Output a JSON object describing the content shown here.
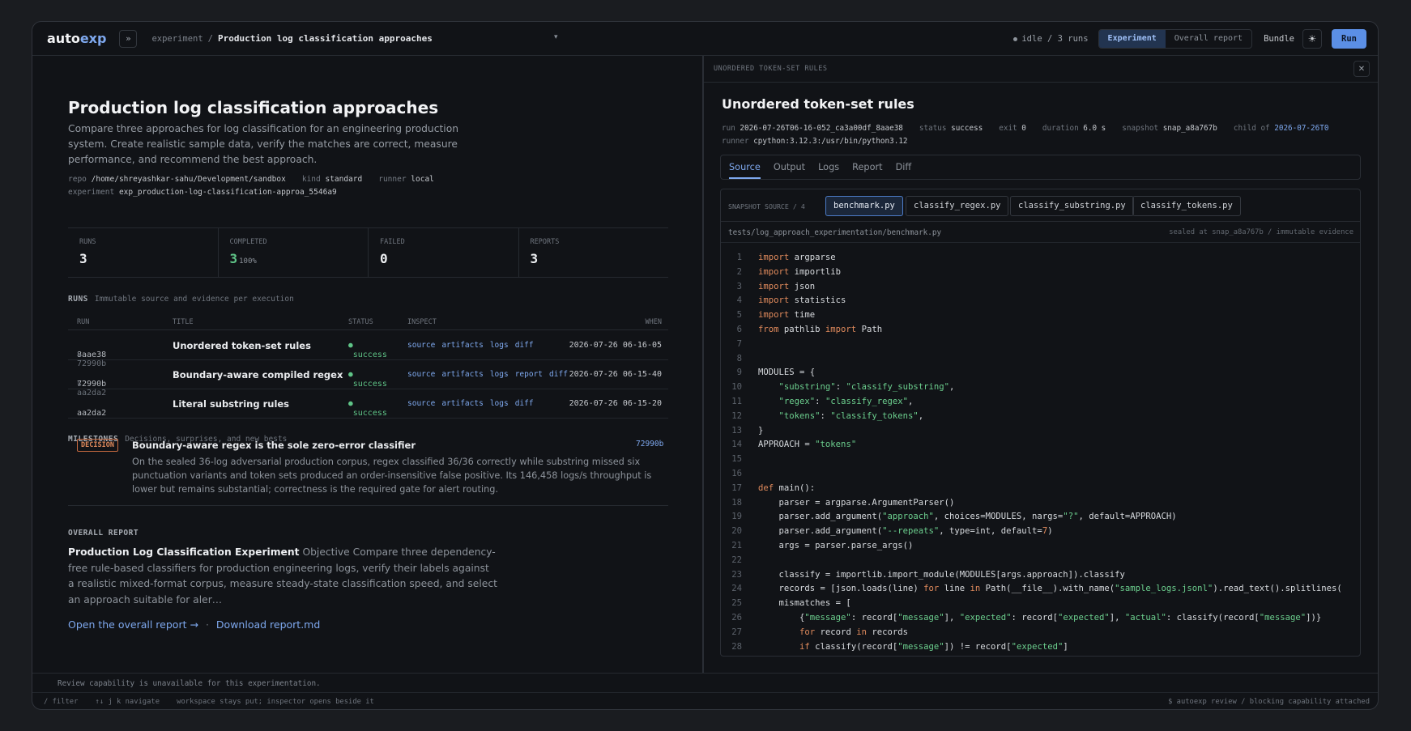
{
  "topbar": {
    "logo_main": "auto",
    "logo_accent": "exp",
    "expand_glyph": "»",
    "crumb_parent": "experiment",
    "crumb_sep": "/",
    "crumb_current": "Production log classification approaches",
    "caret": "▾",
    "status": "idle / 3 runs",
    "tab_experiment": "Experiment",
    "tab_overall": "Overall report",
    "bundle": "Bundle",
    "theme_glyph": "☀",
    "run": "Run"
  },
  "experiment": {
    "title": "Production log classification approaches",
    "description": "Compare three approaches for log classification for an engineering production system. Create realistic sample data, verify the matches are correct, measure performance, and recommend the best approach.",
    "repo_label": "repo",
    "repo": "/home/shreyashkar-sahu/Development/sandbox",
    "kind_label": "kind",
    "kind": "standard",
    "runner_label": "runner",
    "runner": "local",
    "experiment_label": "experiment",
    "experiment_id": "exp_production-log-classification-approa_5546a9"
  },
  "stats": {
    "runs_label": "RUNS",
    "runs": "3",
    "completed_label": "COMPLETED",
    "completed": "3",
    "completed_pct": "100%",
    "failed_label": "FAILED",
    "failed": "0",
    "reports_label": "REPORTS",
    "reports": "3"
  },
  "runs": {
    "title": "RUNS",
    "subtitle": "Immutable source and evidence per execution",
    "col_run": "RUN",
    "col_title": "TITLE",
    "col_status": "STATUS",
    "col_inspect": "INSPECT",
    "col_when": "WHEN",
    "rows": [
      {
        "id": "8aae38",
        "parent": "↳ 72990b",
        "title": "Unordered token-set rules",
        "status": "success",
        "l1": "source",
        "l2": "artifacts",
        "l3": "logs",
        "l4": "diff",
        "l5": "",
        "when": "2026-07-26 06-16-05"
      },
      {
        "id": "72990b",
        "parent": "↳ aa2da2",
        "title": "Boundary-aware compiled regex",
        "status": "success",
        "l1": "source",
        "l2": "artifacts",
        "l3": "logs",
        "l4": "report",
        "l5": "diff",
        "when": "2026-07-26 06-15-40"
      },
      {
        "id": "aa2da2",
        "parent": "",
        "title": "Literal substring rules",
        "status": "success",
        "l1": "source",
        "l2": "artifacts",
        "l3": "logs",
        "l4": "diff",
        "l5": "",
        "when": "2026-07-26 06-15-20"
      }
    ]
  },
  "milestones": {
    "title": "MILESTONES",
    "subtitle": "Decisions, surprises, and new bests",
    "badge": "DECISION",
    "item_title": "Boundary-aware regex is the sole zero-error classifier",
    "item_link": "72990b",
    "item_body": "On the sealed 36-log adversarial production corpus, regex classified 36/36 correctly while substring missed six punctuation variants and token sets produced an order-insensitive false positive. Its 146,458 logs/s throughput is lower but remains substantial; correctness is the required gate for alert routing."
  },
  "overall": {
    "title": "OVERALL REPORT",
    "report_title": "Production Log Classification Experiment",
    "report_text": " Objective Compare three dependency-free rule-based classifiers for production engineering logs, verify their labels against a realistic mixed-format corpus, measure steady-state classification speed, and select an approach suitable for aler…",
    "open_link": "Open the overall report →",
    "sep": "·",
    "download_link": "Download report.md"
  },
  "inspector": {
    "caption": "UNORDERED TOKEN-SET RULES",
    "close": "✕",
    "title": "Unordered token-set rules",
    "run_label": "run",
    "run": "2026-07-26T06-16-052_ca3a00df_8aae38",
    "status_label": "status",
    "status": "success",
    "exit_label": "exit",
    "exit": "0",
    "duration_label": "duration",
    "duration": "6.0 s",
    "snapshot_label": "snapshot",
    "snapshot": "snap_a8a767b",
    "child_label": "child of",
    "child": "2026-07-26T0",
    "runner_label": "runner",
    "runner": "cpython:3.12.3:/usr/bin/python3.12",
    "tabs": {
      "source": "Source",
      "output": "Output",
      "logs": "Logs",
      "report": "Report",
      "diff": "Diff"
    },
    "files_caption": "SNAPSHOT SOURCE / 4",
    "files": [
      "benchmark.py",
      "classify_regex.py",
      "classify_substring.py",
      "classify_tokens.py"
    ],
    "path": "tests/log_approach_experimentation/benchmark.py",
    "sealed": "sealed at snap_a8a767b / immutable evidence"
  },
  "code_lines": [
    "1",
    "2",
    "3",
    "4",
    "5",
    "6",
    "7",
    "8",
    "9",
    "10",
    "11",
    "12",
    "13",
    "14",
    "15",
    "16",
    "17",
    "18",
    "19",
    "20",
    "21",
    "22",
    "23",
    "24",
    "25",
    "26",
    "27",
    "28"
  ],
  "footer": {
    "notice": "Review capability is unavailable for this experimentation.",
    "hints": "/ filter    ↑↓ j k navigate    workspace stays put; inspector opens beside it",
    "right": "$ autoexp review / blocking capability attached"
  },
  "colors": {
    "accent": "#7ea8ee",
    "success": "#5fc487",
    "decision": "#e08a5c",
    "run_button": "#5b8fe6"
  }
}
